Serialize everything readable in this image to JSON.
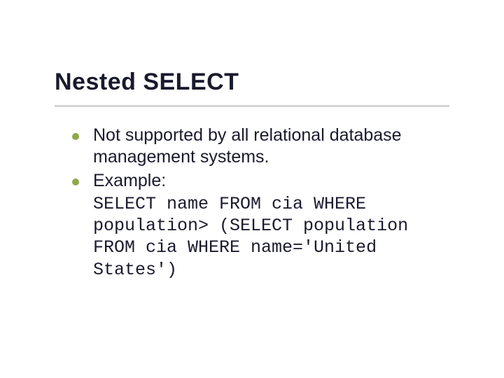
{
  "slide": {
    "title": "Nested SELECT",
    "bullets": [
      {
        "text": "Not supported by all relational database management systems."
      },
      {
        "text": "Example:"
      }
    ],
    "code": "SELECT name FROM cia WHERE population> (SELECT population FROM cia WHERE name='United States')"
  }
}
